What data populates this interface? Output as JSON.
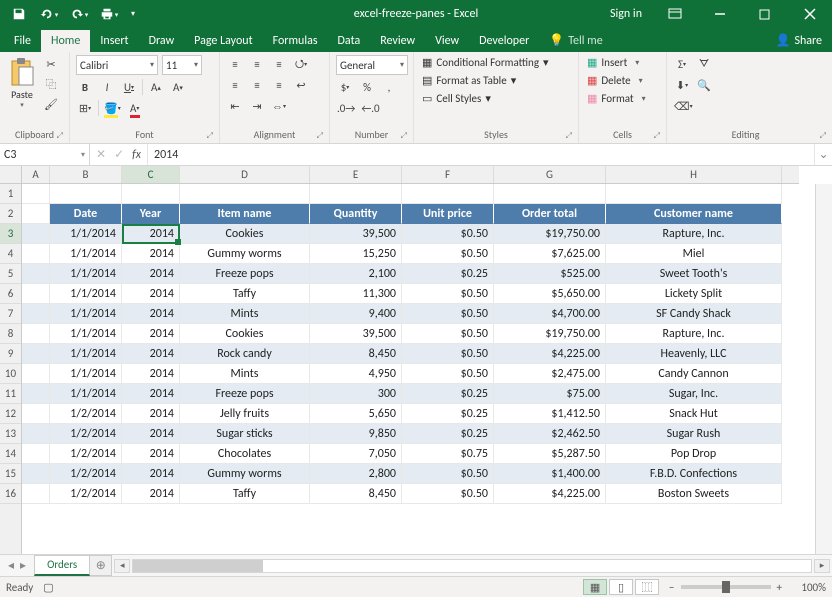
{
  "title": "excel-freeze-panes - Excel",
  "signin": "Sign in",
  "tabs": [
    "File",
    "Home",
    "Insert",
    "Draw",
    "Page Layout",
    "Formulas",
    "Data",
    "Review",
    "View",
    "Developer"
  ],
  "tellme": "Tell me",
  "share": "Share",
  "ribbon": {
    "clipboard": "Clipboard",
    "paste": "Paste",
    "font_group": "Font",
    "font_name": "Calibri",
    "font_size": "11",
    "alignment": "Alignment",
    "number_group": "Number",
    "number_format": "General",
    "styles_group": "Styles",
    "cond_fmt": "Conditional Formatting",
    "fmt_table": "Format as Table",
    "cell_styles": "Cell Styles",
    "cells_group": "Cells",
    "insert": "Insert",
    "delete": "Delete",
    "format": "Format",
    "editing_group": "Editing"
  },
  "namebox": "C3",
  "formula_value": "2014",
  "col_labels": [
    "A",
    "B",
    "C",
    "D",
    "E",
    "F",
    "G",
    "H"
  ],
  "row_labels": [
    "1",
    "2",
    "3",
    "4",
    "5",
    "6",
    "7",
    "8",
    "9",
    "10",
    "11",
    "12",
    "13",
    "14",
    "15",
    "16"
  ],
  "headers": [
    "Date",
    "Year",
    "Item name",
    "Quantity",
    "Unit price",
    "Order total",
    "Customer name"
  ],
  "rows": [
    {
      "date": "1/1/2014",
      "year": "2014",
      "item": "Cookies",
      "qty": "39,500",
      "unit": "$0.50",
      "total": "$19,750.00",
      "cust": "Rapture, Inc."
    },
    {
      "date": "1/1/2014",
      "year": "2014",
      "item": "Gummy worms",
      "qty": "15,250",
      "unit": "$0.50",
      "total": "$7,625.00",
      "cust": "Miel"
    },
    {
      "date": "1/1/2014",
      "year": "2014",
      "item": "Freeze pops",
      "qty": "2,100",
      "unit": "$0.25",
      "total": "$525.00",
      "cust": "Sweet Tooth's"
    },
    {
      "date": "1/1/2014",
      "year": "2014",
      "item": "Taffy",
      "qty": "11,300",
      "unit": "$0.50",
      "total": "$5,650.00",
      "cust": "Lickety Split"
    },
    {
      "date": "1/1/2014",
      "year": "2014",
      "item": "Mints",
      "qty": "9,400",
      "unit": "$0.50",
      "total": "$4,700.00",
      "cust": "SF Candy Shack"
    },
    {
      "date": "1/1/2014",
      "year": "2014",
      "item": "Cookies",
      "qty": "39,500",
      "unit": "$0.50",
      "total": "$19,750.00",
      "cust": "Rapture, Inc."
    },
    {
      "date": "1/1/2014",
      "year": "2014",
      "item": "Rock candy",
      "qty": "8,450",
      "unit": "$0.50",
      "total": "$4,225.00",
      "cust": "Heavenly, LLC"
    },
    {
      "date": "1/1/2014",
      "year": "2014",
      "item": "Mints",
      "qty": "4,950",
      "unit": "$0.50",
      "total": "$2,475.00",
      "cust": "Candy Cannon"
    },
    {
      "date": "1/1/2014",
      "year": "2014",
      "item": "Freeze pops",
      "qty": "300",
      "unit": "$0.25",
      "total": "$75.00",
      "cust": "Sugar, Inc."
    },
    {
      "date": "1/2/2014",
      "year": "2014",
      "item": "Jelly fruits",
      "qty": "5,650",
      "unit": "$0.25",
      "total": "$1,412.50",
      "cust": "Snack Hut"
    },
    {
      "date": "1/2/2014",
      "year": "2014",
      "item": "Sugar sticks",
      "qty": "9,850",
      "unit": "$0.25",
      "total": "$2,462.50",
      "cust": "Sugar Rush"
    },
    {
      "date": "1/2/2014",
      "year": "2014",
      "item": "Chocolates",
      "qty": "7,050",
      "unit": "$0.75",
      "total": "$5,287.50",
      "cust": "Pop Drop"
    },
    {
      "date": "1/2/2014",
      "year": "2014",
      "item": "Gummy worms",
      "qty": "2,800",
      "unit": "$0.50",
      "total": "$1,400.00",
      "cust": "F.B.D. Confections"
    },
    {
      "date": "1/2/2014",
      "year": "2014",
      "item": "Taffy",
      "qty": "8,450",
      "unit": "$0.50",
      "total": "$4,225.00",
      "cust": "Boston Sweets"
    }
  ],
  "sheet_tab": "Orders",
  "status": "Ready",
  "zoom": "100%"
}
